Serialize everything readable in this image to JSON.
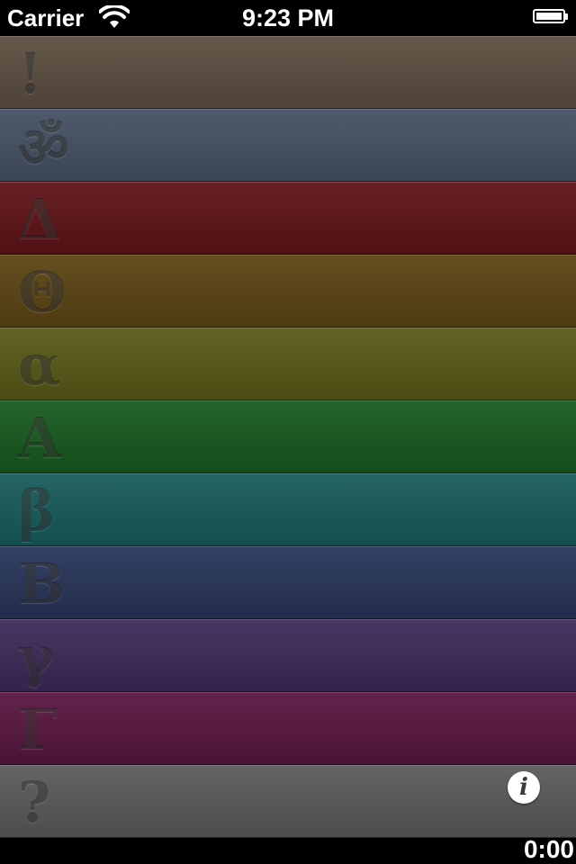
{
  "status_bar": {
    "carrier": "Carrier",
    "time": "9:23 PM",
    "wifi_icon": "wifi-icon",
    "battery_icon": "battery-icon"
  },
  "rows": [
    {
      "symbol": "!",
      "color": "#5b4e40"
    },
    {
      "symbol": "ॐ",
      "color": "#445063"
    },
    {
      "symbol": "Δ",
      "color": "#5e1317"
    },
    {
      "symbol": "Θ",
      "color": "#5b4413"
    },
    {
      "symbol": "α",
      "color": "#585917"
    },
    {
      "symbol": "A",
      "color": "#175a1f"
    },
    {
      "symbol": "β",
      "color": "#185b5b"
    },
    {
      "symbol": "B",
      "color": "#283559"
    },
    {
      "symbol": "γ",
      "color": "#3e2958"
    },
    {
      "symbol": "Γ",
      "color": "#58163f"
    },
    {
      "symbol": "?",
      "color": "#5a5a5a"
    }
  ],
  "info_button": {
    "label": "i",
    "icon": "info-icon"
  },
  "timer": "0:00"
}
